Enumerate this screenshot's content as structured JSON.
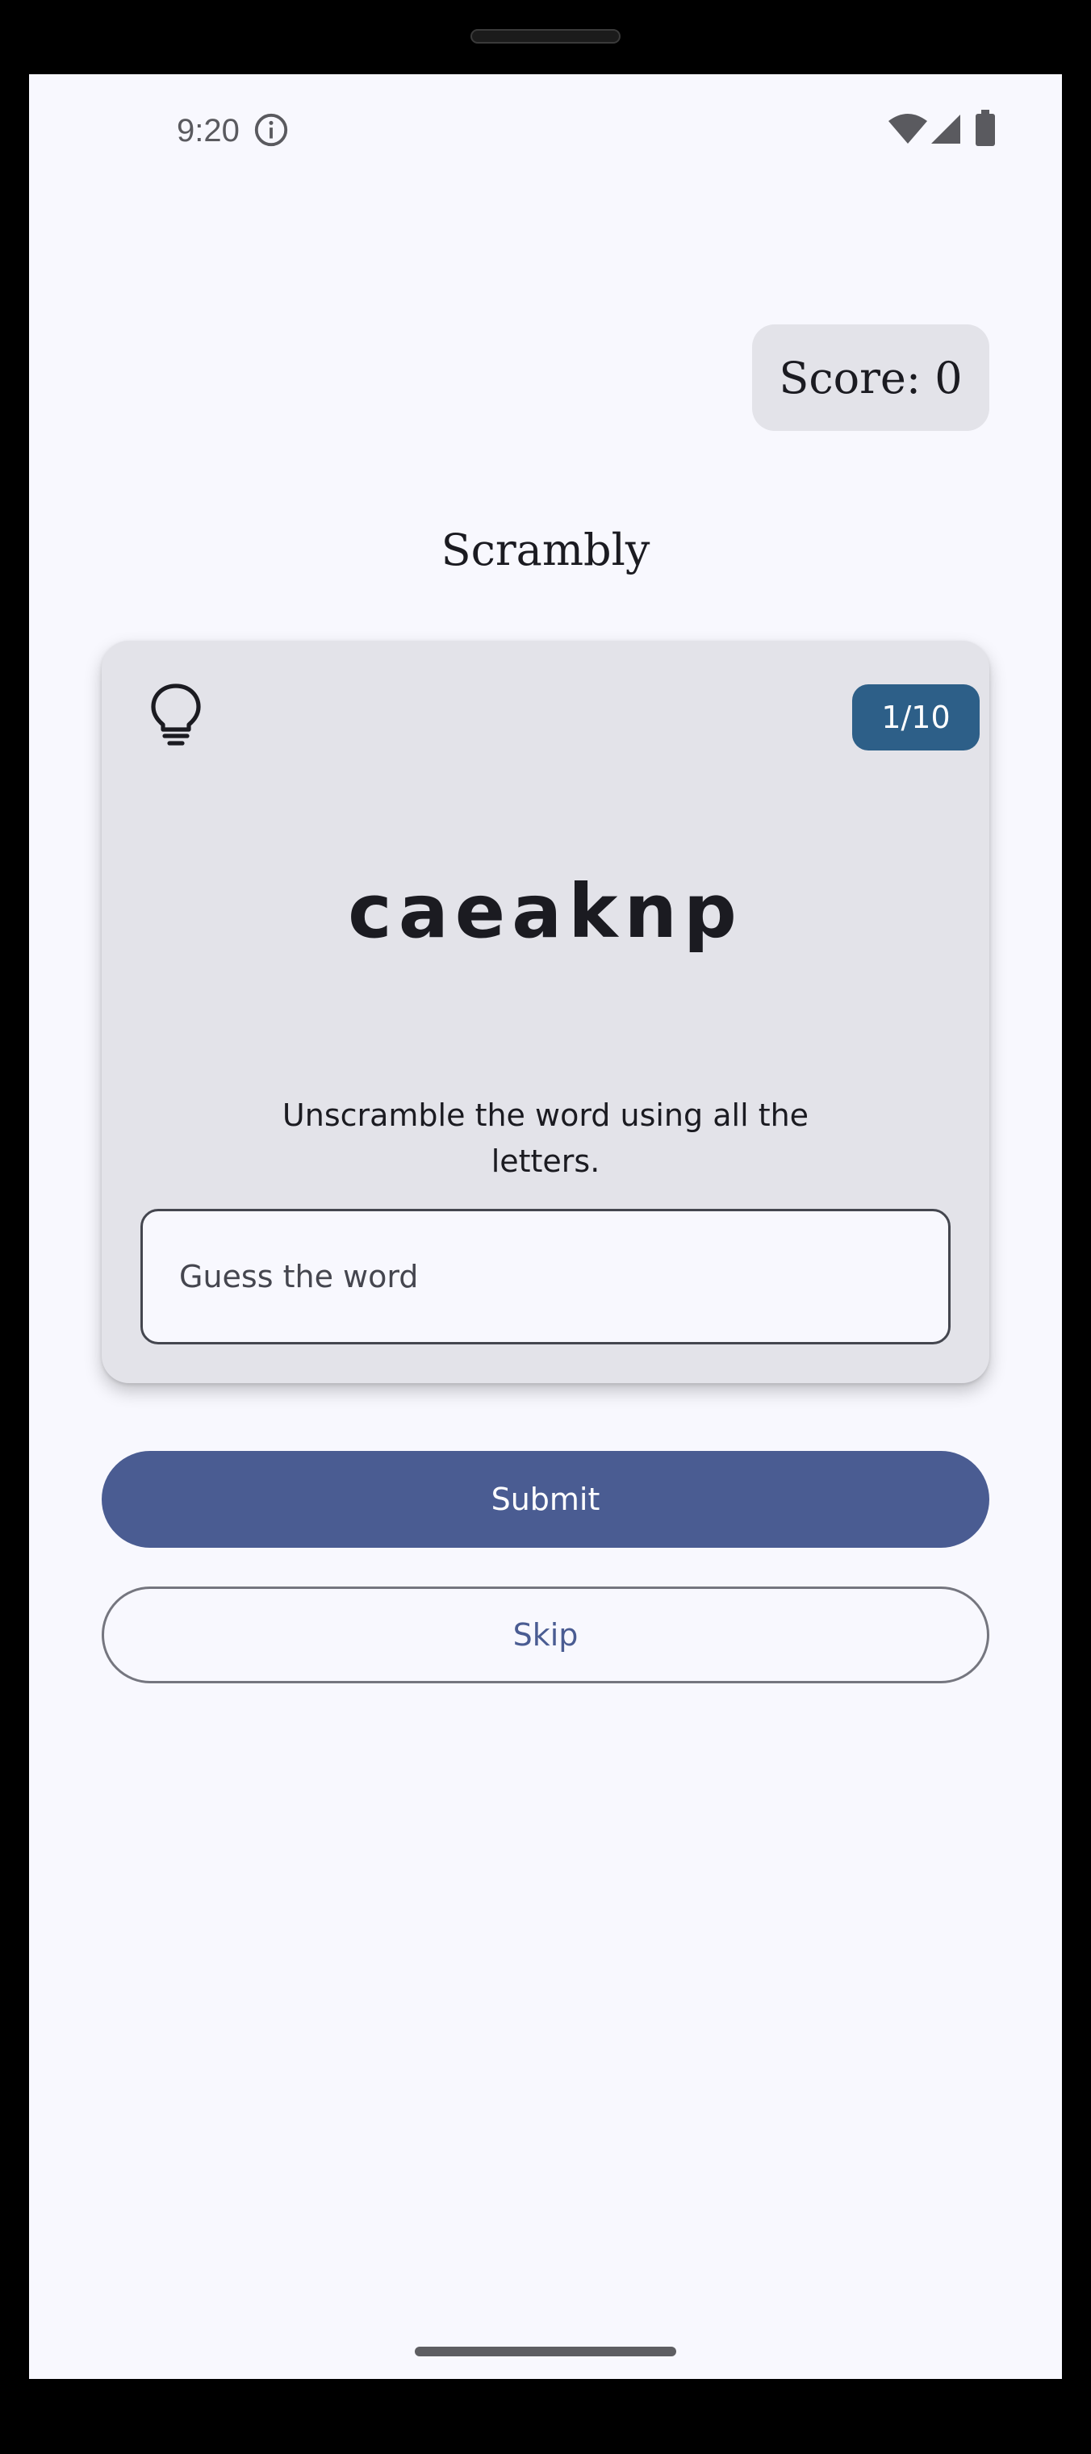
{
  "status_bar": {
    "time": "9:20",
    "icons": [
      "info-icon",
      "wifi-icon",
      "signal-icon",
      "battery-icon"
    ]
  },
  "header": {
    "score_label": "Score: 0"
  },
  "app": {
    "title": "Scrambly"
  },
  "card": {
    "hint_icon": "lightbulb-icon",
    "word_count": "1/10",
    "scrambled_word": "caeaknp",
    "instructions": "Unscramble the word using all the letters.",
    "guess_placeholder": "Guess the word",
    "guess_value": ""
  },
  "actions": {
    "submit_label": "Submit",
    "skip_label": "Skip"
  },
  "colors": {
    "background": "#f8f8fe",
    "surface_variant": "#e3e3e9",
    "primary": "#4a5c92",
    "badge": "#2d5f88",
    "outline": "#75767f",
    "on_surface": "#1b1b21"
  }
}
